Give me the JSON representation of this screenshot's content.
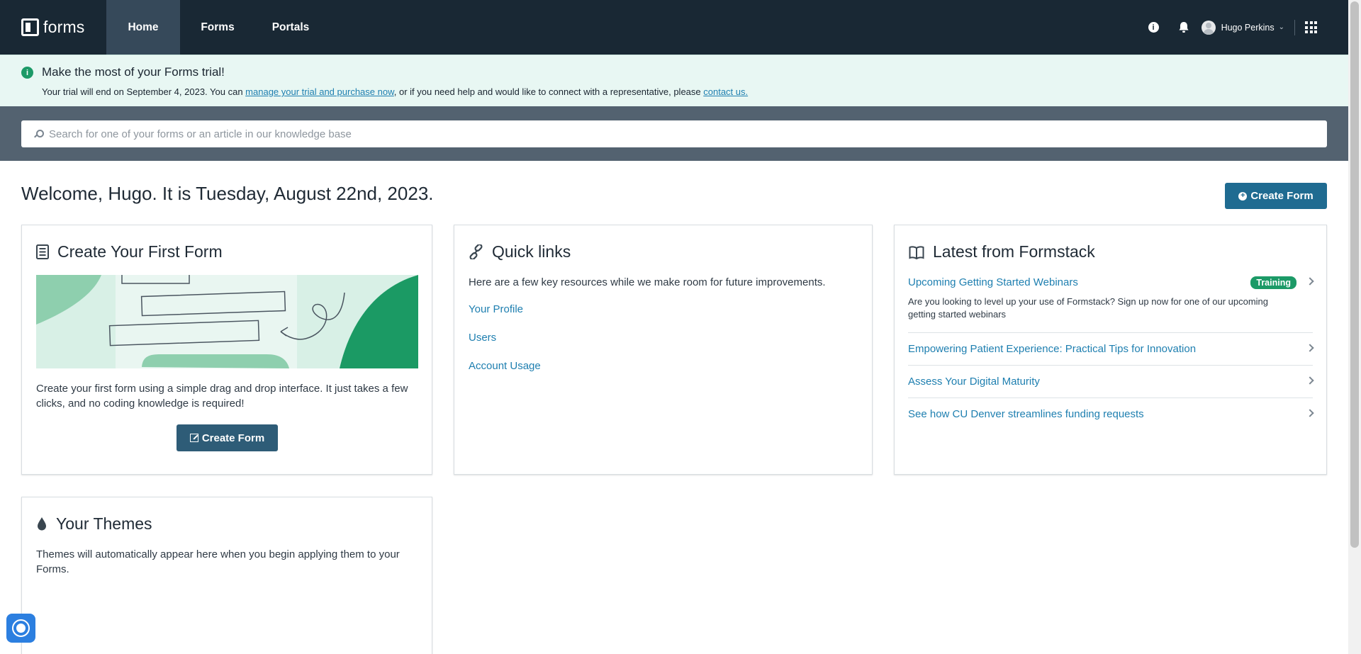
{
  "nav": {
    "brand": "forms",
    "tabs": [
      {
        "label": "Home"
      },
      {
        "label": "Forms"
      },
      {
        "label": "Portals"
      }
    ],
    "user_name": "Hugo Perkins",
    "icons": [
      "info-icon",
      "bell-icon",
      "apps-grid-icon"
    ]
  },
  "banner": {
    "title": "Make the most of your Forms trial!",
    "text_before": "Your trial will end on September 4, 2023. You can ",
    "link_manage": "manage your trial and purchase now",
    "text_middle": ", or if you need help and would like to connect with a representative, please ",
    "link_contact": "contact us."
  },
  "search": {
    "placeholder": "Search for one of your forms or an article in our knowledge base"
  },
  "welcome": "Welcome, Hugo. It is Tuesday, August 22nd, 2023.",
  "create_form_label": "Create Form",
  "first_form": {
    "title": "Create Your First Form",
    "text": "Create your first form using a simple drag and drop interface. It just takes a few clicks, and no coding knowledge is required!",
    "button": "Create Form"
  },
  "quick_links": {
    "title": "Quick links",
    "intro": "Here are a few key resources while we make room for future improvements.",
    "links": [
      "Your Profile",
      "Users",
      "Account Usage"
    ]
  },
  "latest": {
    "title": "Latest from Formstack",
    "items": [
      {
        "title": "Upcoming Getting Started Webinars",
        "badge": "Training",
        "desc": "Are you looking to level up your use of Formstack? Sign up now for one of our upcoming getting started webinars"
      },
      {
        "title": "Empowering Patient Experience: Practical Tips for Innovation"
      },
      {
        "title": "Assess Your Digital Maturity"
      },
      {
        "title": "See how CU Denver streamlines funding requests"
      }
    ]
  },
  "themes": {
    "title": "Your Themes",
    "text": "Themes will automatically appear here when you begin applying them to your Forms."
  },
  "colors": {
    "nav_bg": "#192834",
    "nav_active": "#36495a",
    "banner_bg": "#e8f7f3",
    "search_band": "#536270",
    "primary_button": "#1f6b91",
    "link": "#1e7fb0",
    "badge": "#1c9a67"
  }
}
